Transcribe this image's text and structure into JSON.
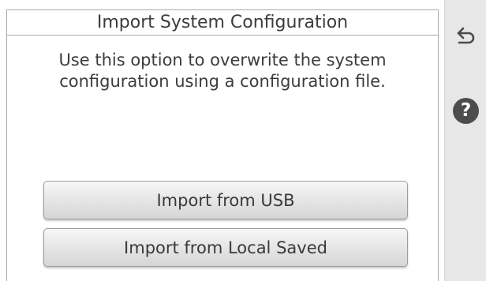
{
  "dialog": {
    "title": "Import System Configuration",
    "description_line1": "Use this option to overwrite the system",
    "description_line2": "configuration using a configuration file."
  },
  "buttons": {
    "import_usb": "Import from USB",
    "import_local": "Import from Local Saved"
  },
  "sidebar": {
    "back_icon": "back-arrow-icon",
    "help_icon": "help-icon",
    "help_glyph": "?"
  }
}
